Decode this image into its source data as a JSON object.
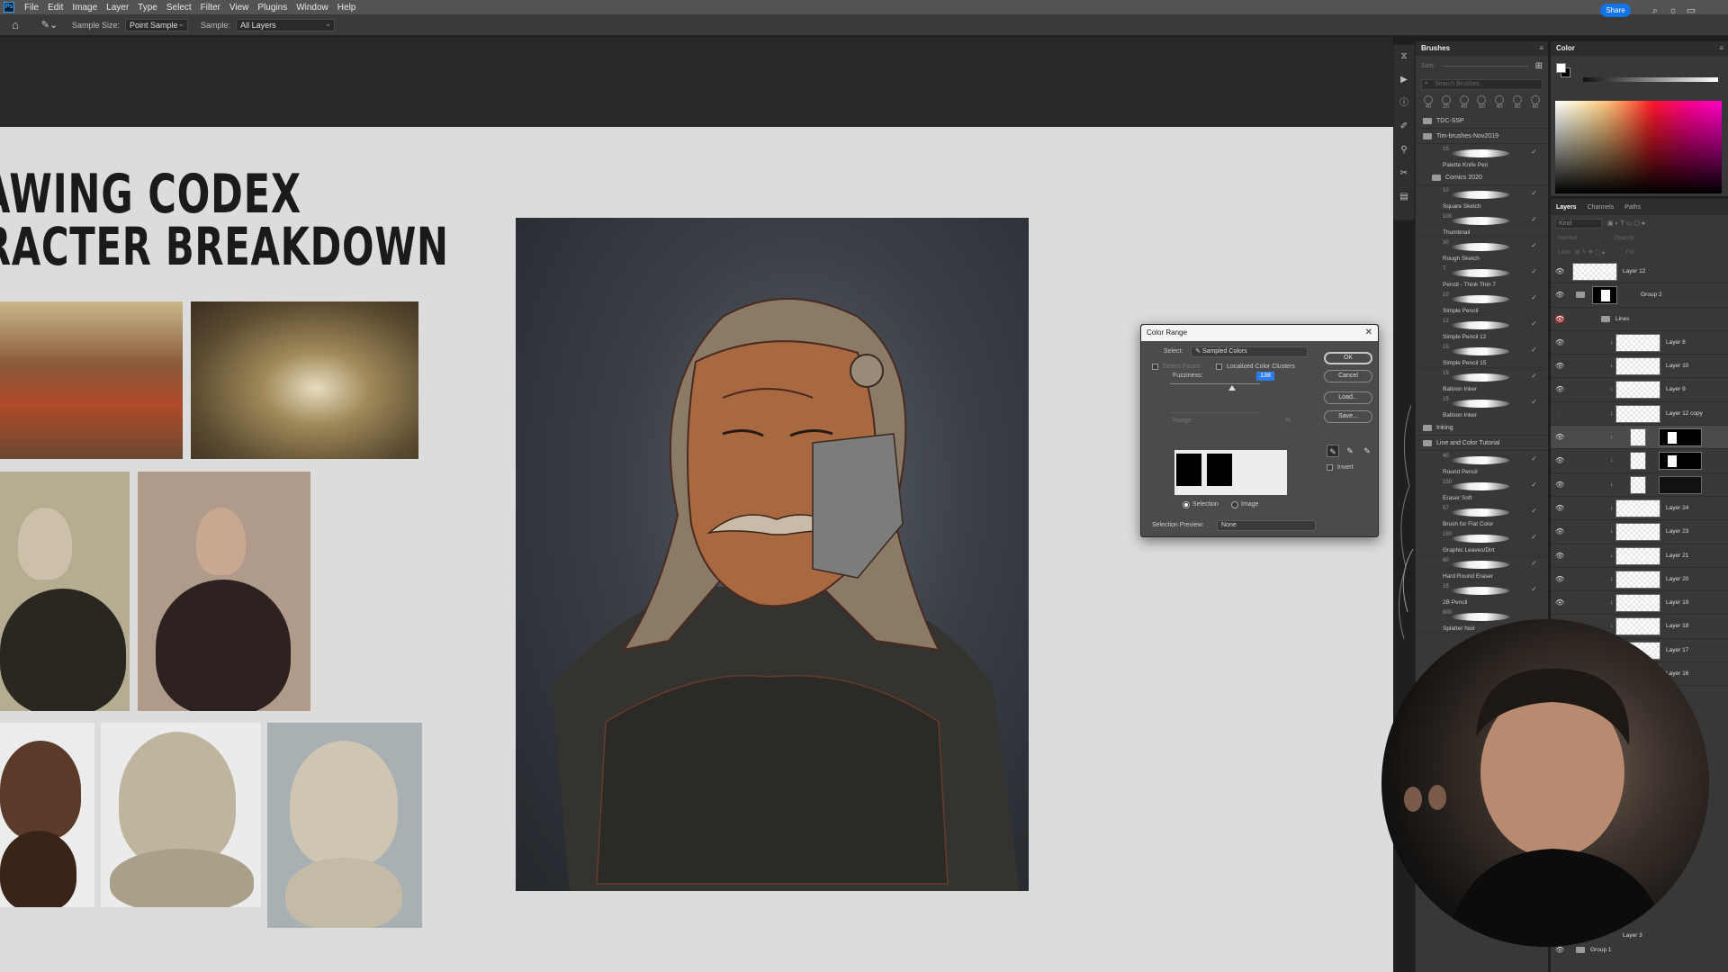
{
  "app": {
    "menu": [
      "File",
      "Edit",
      "Image",
      "Layer",
      "Type",
      "Select",
      "Filter",
      "View",
      "Plugins",
      "Window",
      "Help"
    ],
    "share_label": "Share"
  },
  "options_bar": {
    "sample_size_label": "Sample Size:",
    "sample_size_value": "Point Sample",
    "sample_label": "Sample:",
    "sample_value": "All Layers"
  },
  "canvas": {
    "title_line1": "AWING CODEX",
    "title_line2": "RACTER BREAKDOWN"
  },
  "brushes_panel": {
    "tab": "Brushes",
    "size_label": "Size:",
    "search_placeholder": "Search Brushes",
    "recent_sizes": [
      "40",
      "20",
      "40",
      "50",
      "60",
      "60",
      "60"
    ],
    "folder_1": "TDC-SSP",
    "folder_2": "Tim-brushes-Nov2019",
    "first_brush": {
      "num": "15",
      "name": "Palette Knife Pen"
    },
    "subfolder_1": "Comics 2020",
    "brushes_1": [
      {
        "num": "10",
        "name": "Square Sketch"
      },
      {
        "num": "100",
        "name": "Thumbnail"
      },
      {
        "num": "30",
        "name": "Rough Sketch"
      },
      {
        "num": "7",
        "name": "Pencil - Think Thin 7"
      },
      {
        "num": "10",
        "name": "Simple Pencil"
      },
      {
        "num": "12",
        "name": "Simple Pencil 12"
      },
      {
        "num": "15",
        "name": "Simple Pencil 15"
      },
      {
        "num": "15",
        "name": "Balloon Inker"
      },
      {
        "num": "15",
        "name": "Balloon Inker"
      }
    ],
    "folder_3": "Inking",
    "folder_4": "Line and Color Tutorial",
    "brushes_2": [
      {
        "num": "40",
        "name": "Round Pencil"
      },
      {
        "num": "150",
        "name": "Eraser Soft"
      },
      {
        "num": "57",
        "name": "Brush for Flat Color"
      },
      {
        "num": "150",
        "name": "Graphic Leaves/Dirt"
      },
      {
        "num": "60",
        "name": "Hard Round Eraser"
      },
      {
        "num": "15",
        "name": "2B Pencil"
      },
      {
        "num": "800",
        "name": "Splatter Noir"
      }
    ],
    "bottom_num": "70"
  },
  "color_panel": {
    "tab": "Color"
  },
  "layers_panel": {
    "tabs": [
      "Layers",
      "Channels",
      "Paths"
    ],
    "kind_label": "Kind",
    "blend_mode": "Normal",
    "opacity_label": "Opacity:",
    "lock_label": "Lock:",
    "fill_label": "Fill:",
    "layers": [
      {
        "name": "Layer 12"
      },
      {
        "name": "Group 2"
      },
      {
        "name": "Lines"
      },
      {
        "name": "Layer 8"
      },
      {
        "name": "Layer 10"
      },
      {
        "name": "Layer 9"
      },
      {
        "name": "Layer 12 copy"
      },
      {
        "name": ""
      },
      {
        "name": ""
      },
      {
        "name": ""
      },
      {
        "name": "Layer 24"
      },
      {
        "name": "Layer 23"
      },
      {
        "name": "Layer 21"
      },
      {
        "name": "Layer 20"
      },
      {
        "name": "Layer 19"
      },
      {
        "name": "Layer 18"
      },
      {
        "name": "Layer 17"
      },
      {
        "name": "Layer 16"
      }
    ],
    "bottom_layers": [
      {
        "name": "Layer 3"
      },
      {
        "name": "Group 1"
      }
    ]
  },
  "color_range_dialog": {
    "title": "Color Range",
    "select_label": "Select:",
    "select_value": "Sampled Colors",
    "detect_faces": "Detect Faces",
    "localized_clusters": "Localized Color Clusters",
    "fuzziness_label": "Fuzziness:",
    "fuzziness_value": "138",
    "range_label": "Range:",
    "range_unit": "%",
    "ok_label": "OK",
    "cancel_label": "Cancel",
    "load_label": "Load...",
    "save_label": "Save...",
    "invert_label": "Invert",
    "selection_radio": "Selection",
    "image_radio": "Image",
    "preview_label": "Selection Preview:",
    "preview_value": "None"
  },
  "colors": {
    "accent_blue": "#1473e6",
    "visibility_red": "#8c2a2a"
  }
}
